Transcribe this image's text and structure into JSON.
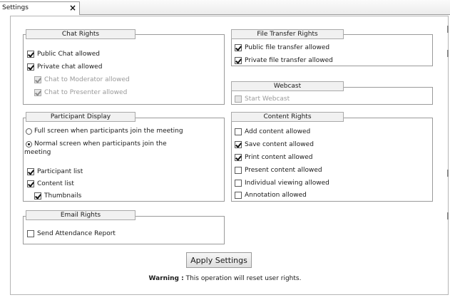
{
  "tab": {
    "title": "Settings",
    "close_glyph": "×"
  },
  "chat_rights": {
    "title": "Chat Rights",
    "public_chat": {
      "label": "Public Chat allowed",
      "checked": true
    },
    "private_chat": {
      "label": "Private chat allowed",
      "checked": true
    },
    "chat_to_moderator": {
      "label": "Chat to Moderator allowed",
      "checked": true,
      "disabled": true
    },
    "chat_to_presenter": {
      "label": "Chat to Presenter allowed",
      "checked": true,
      "disabled": true
    }
  },
  "file_transfer_rights": {
    "title": "File Transfer Rights",
    "public_transfer": {
      "label": "Public file transfer allowed",
      "checked": true
    },
    "private_transfer": {
      "label": "Private file transfer allowed",
      "checked": true
    }
  },
  "webcast": {
    "title": "Webcast",
    "start_webcast": {
      "label": "Start Webcast",
      "checked": false,
      "disabled": true
    }
  },
  "participant_display": {
    "title": "Participant Display",
    "full_screen": {
      "label": "Full screen when participants join the meeting",
      "selected": false
    },
    "normal_screen": {
      "label_line1": "Normal screen when participants join the",
      "label_line2": "meeting",
      "selected": true
    },
    "participant_list": {
      "label": "Participant list",
      "checked": true
    },
    "content_list": {
      "label": "Content list",
      "checked": true
    },
    "thumbnails": {
      "label": "Thumbnails",
      "checked": true
    }
  },
  "content_rights": {
    "title": "Content Rights",
    "add_content": {
      "label": "Add content allowed",
      "checked": false
    },
    "save_content": {
      "label": "Save content allowed",
      "checked": true
    },
    "print_content": {
      "label": "Print content allowed",
      "checked": true
    },
    "present_content": {
      "label": "Present content allowed",
      "checked": false
    },
    "individual_viewing": {
      "label": "Individual viewing allowed",
      "checked": false
    },
    "annotation": {
      "label": "Annotation allowed",
      "checked": false
    }
  },
  "email_rights": {
    "title": "Email Rights",
    "send_attendance": {
      "label": "Send Attendance Report",
      "checked": false
    }
  },
  "apply_button": {
    "label": "Apply Settings"
  },
  "warning": {
    "prefix": "Warning :",
    "text": " This operation will reset user rights."
  }
}
